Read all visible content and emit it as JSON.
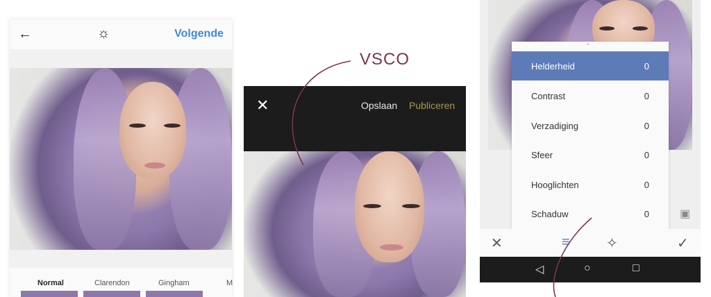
{
  "instagram": {
    "next_label": "Volgende",
    "back_icon": "arrow-left-icon",
    "lux_icon": "lux-icon",
    "filters": [
      "Normal",
      "Clarendon",
      "Gingham",
      "M"
    ]
  },
  "vsco": {
    "annotation": "VSCO",
    "close_icon": "close-icon",
    "save_label": "Opslaan",
    "publish_label": "Publiceren",
    "accent": "#a8974f"
  },
  "snapseed": {
    "rows": [
      {
        "label": "Helderheid",
        "value": "0"
      },
      {
        "label": "Contrast",
        "value": "0"
      },
      {
        "label": "Verzadiging",
        "value": "0"
      },
      {
        "label": "Sfeer",
        "value": "0"
      },
      {
        "label": "Hooglichten",
        "value": "0"
      },
      {
        "label": "Schaduw",
        "value": "0"
      }
    ],
    "active_color": "#5d7cb7"
  },
  "colors": {
    "annotation_line": "#7a3553",
    "instagram_blue": "#3e8cd8"
  }
}
